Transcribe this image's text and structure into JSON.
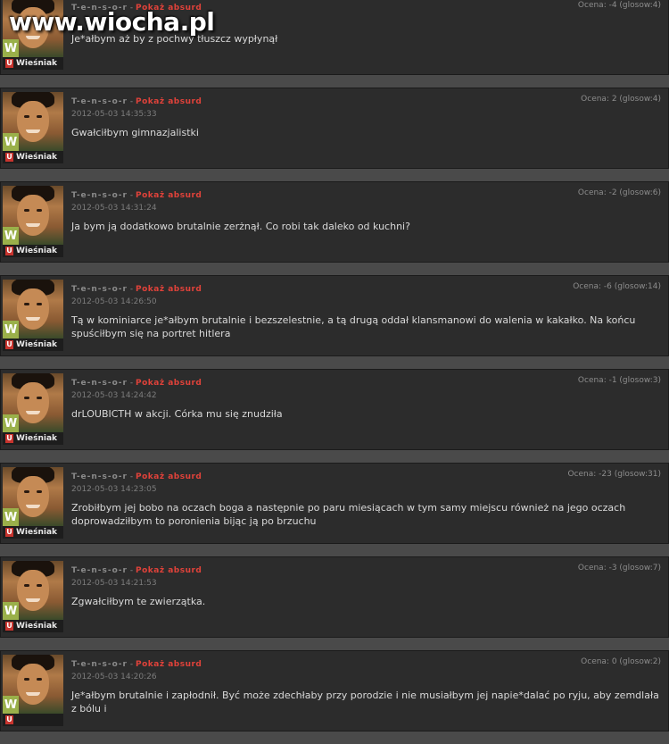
{
  "watermark": "www.wiocha.pl",
  "comments": [
    {
      "author": "T-e-n-s-o-r",
      "sep": "-",
      "absurd": "Pokaż absurd",
      "date": "",
      "rating": "Ocena: -4 (glosow:4)",
      "text": "Je*ałbym aż by z pochwy tłuszcz wypłynął",
      "badge": "Wieśniak"
    },
    {
      "author": "T-e-n-s-o-r",
      "sep": "-",
      "absurd": "Pokaż absurd",
      "date": "2012-05-03 14:35:33",
      "rating": "Ocena: 2 (glosow:4)",
      "text": "Gwałciłbym gimnazjalistki",
      "badge": "Wieśniak"
    },
    {
      "author": "T-e-n-s-o-r",
      "sep": "-",
      "absurd": "Pokaż absurd",
      "date": "2012-05-03 14:31:24",
      "rating": "Ocena: -2 (glosow:6)",
      "text": "Ja bym ją dodatkowo brutalnie zerżnął. Co robi tak daleko od kuchni?",
      "badge": "Wieśniak"
    },
    {
      "author": "T-e-n-s-o-r",
      "sep": "-",
      "absurd": "Pokaż absurd",
      "date": "2012-05-03 14:26:50",
      "rating": "Ocena: -6 (glosow:14)",
      "text": "Tą w kominiarce je*ałbym brutalnie i bezszelestnie, a tą drugą oddał klansmanowi do walenia w kakałko. Na końcu spuściłbym się na portret hitlera",
      "badge": "Wieśniak"
    },
    {
      "author": "T-e-n-s-o-r",
      "sep": "-",
      "absurd": "Pokaż absurd",
      "date": "2012-05-03 14:24:42",
      "rating": "Ocena: -1 (glosow:3)",
      "text": "drLOUBICTH w akcji. Córka mu się znudziła",
      "badge": "Wieśniak"
    },
    {
      "author": "T-e-n-s-o-r",
      "sep": "-",
      "absurd": "Pokaż absurd",
      "date": "2012-05-03 14:23:05",
      "rating": "Ocena: -23 (glosow:31)",
      "text": "Zrobiłbym jej bobo na oczach boga a następnie po paru miesiącach w tym samy miejscu również na jego oczach doprowadziłbym to poronienia bijąc ją po brzuchu",
      "badge": "Wieśniak"
    },
    {
      "author": "T-e-n-s-o-r",
      "sep": "-",
      "absurd": "Pokaż absurd",
      "date": "2012-05-03 14:21:53",
      "rating": "Ocena: -3 (glosow:7)",
      "text": "Zgwałciłbym te zwierzątka.",
      "badge": "Wieśniak"
    },
    {
      "author": "T-e-n-s-o-r",
      "sep": "-",
      "absurd": "Pokaż absurd",
      "date": "2012-05-03 14:20:26",
      "rating": "Ocena: 0 (glosow:2)",
      "text": "Je*ałbym brutalnie i zapłodnił. Być może zdechłaby przy porodzie i nie musiałbym jej napie*dalać po ryju, aby zemdlała z bólu i",
      "badge": ""
    }
  ]
}
